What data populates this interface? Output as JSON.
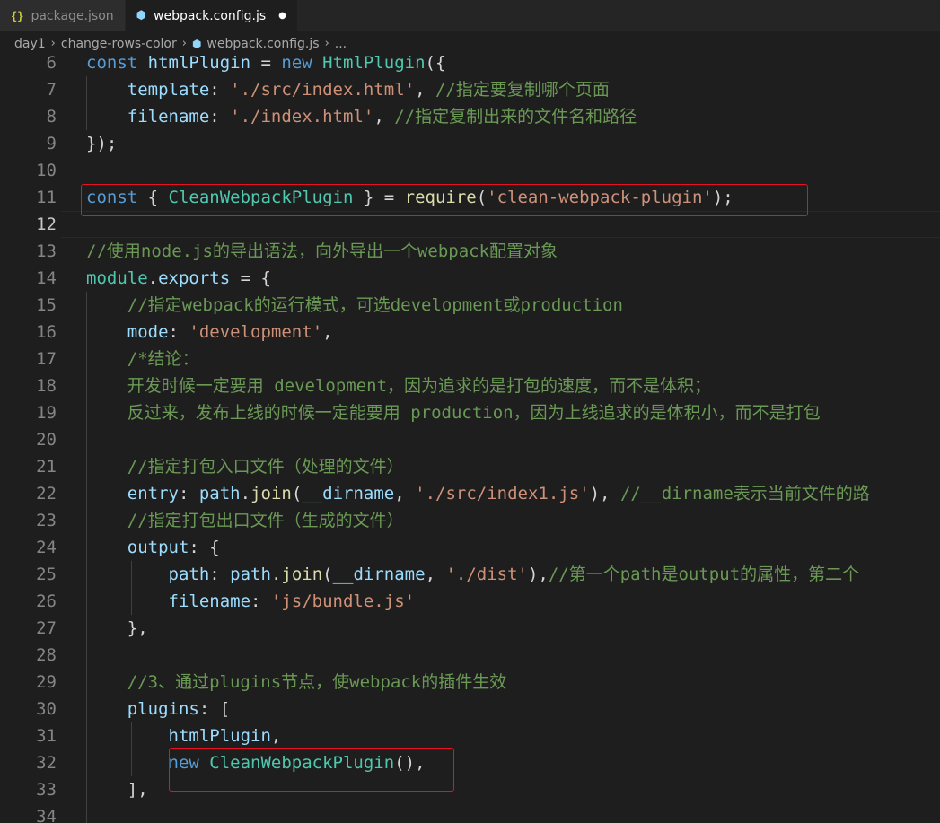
{
  "tabs": [
    {
      "name": "package-json",
      "icon": "json-braces-icon",
      "icon_text": "{}",
      "label": "package.json",
      "active": false
    },
    {
      "name": "webpack-config-js",
      "icon": "webpack-cube-icon",
      "icon_text": "⬢",
      "label": "webpack.config.js",
      "active": true,
      "dirty_marker": "●"
    }
  ],
  "breadcrumb": {
    "items": [
      "day1",
      "change-rows-color",
      "webpack.config.js",
      "..."
    ],
    "separator": "›"
  },
  "editor": {
    "line_numbers": [
      "6",
      "7",
      "8",
      "9",
      "10",
      "11",
      "12",
      "13",
      "14",
      "15",
      "16",
      "17",
      "18",
      "19",
      "20",
      "21",
      "22",
      "23",
      "24",
      "25",
      "26",
      "27",
      "28",
      "29",
      "30",
      "31",
      "32",
      "33",
      "34"
    ],
    "current_line": "12",
    "lines": [
      [
        [
          "kw",
          "const "
        ],
        [
          "var",
          "htmlPlugin "
        ],
        [
          "plain",
          "= "
        ],
        [
          "kw",
          "new "
        ],
        [
          "cls",
          "HtmlPlugin"
        ],
        [
          "plain",
          "({"
        ]
      ],
      [
        [
          "plain",
          "    "
        ],
        [
          "var",
          "template"
        ],
        [
          "plain",
          ": "
        ],
        [
          "str",
          "'./src/index.html'"
        ],
        [
          "plain",
          ", "
        ],
        [
          "cmt",
          "//指定要复制哪个页面"
        ]
      ],
      [
        [
          "plain",
          "    "
        ],
        [
          "var",
          "filename"
        ],
        [
          "plain",
          ": "
        ],
        [
          "str",
          "'./index.html'"
        ],
        [
          "plain",
          ", "
        ],
        [
          "cmt",
          "//指定复制出来的文件名和路径"
        ]
      ],
      [
        [
          "plain",
          "});"
        ]
      ],
      [],
      [
        [
          "kw",
          "const "
        ],
        [
          "plain",
          "{ "
        ],
        [
          "cls",
          "CleanWebpackPlugin"
        ],
        [
          "plain",
          " } = "
        ],
        [
          "fn",
          "require"
        ],
        [
          "plain",
          "("
        ],
        [
          "str",
          "'clean-webpack-plugin'"
        ],
        [
          "plain",
          ");"
        ]
      ],
      [],
      [
        [
          "cmt",
          "//使用node.js的导出语法，向外导出一个webpack配置对象"
        ]
      ],
      [
        [
          "cls",
          "module"
        ],
        [
          "plain",
          "."
        ],
        [
          "var",
          "exports"
        ],
        [
          "plain",
          " = {"
        ]
      ],
      [
        [
          "plain",
          "    "
        ],
        [
          "cmt",
          "//指定webpack的运行模式，可选development或production"
        ]
      ],
      [
        [
          "plain",
          "    "
        ],
        [
          "var",
          "mode"
        ],
        [
          "plain",
          ": "
        ],
        [
          "str",
          "'development'"
        ],
        [
          "plain",
          ","
        ]
      ],
      [
        [
          "plain",
          "    "
        ],
        [
          "cmt",
          "/*结论："
        ]
      ],
      [
        [
          "plain",
          "    "
        ],
        [
          "cmt",
          "开发时候一定要用 development，因为追求的是打包的速度，而不是体积；"
        ]
      ],
      [
        [
          "plain",
          "    "
        ],
        [
          "cmt",
          "反过来，发布上线的时候一定能要用 production，因为上线追求的是体积小，而不是打包"
        ]
      ],
      [],
      [
        [
          "plain",
          "    "
        ],
        [
          "cmt",
          "//指定打包入口文件（处理的文件）"
        ]
      ],
      [
        [
          "plain",
          "    "
        ],
        [
          "var",
          "entry"
        ],
        [
          "plain",
          ": "
        ],
        [
          "var",
          "path"
        ],
        [
          "plain",
          "."
        ],
        [
          "fn",
          "join"
        ],
        [
          "plain",
          "("
        ],
        [
          "var",
          "__dirname"
        ],
        [
          "plain",
          ", "
        ],
        [
          "str",
          "'./src/index1.js'"
        ],
        [
          "plain",
          "), "
        ],
        [
          "cmt",
          "//__dirname表示当前文件的路"
        ]
      ],
      [
        [
          "plain",
          "    "
        ],
        [
          "cmt",
          "//指定打包出口文件（生成的文件）"
        ]
      ],
      [
        [
          "plain",
          "    "
        ],
        [
          "var",
          "output"
        ],
        [
          "plain",
          ": {"
        ]
      ],
      [
        [
          "plain",
          "        "
        ],
        [
          "var",
          "path"
        ],
        [
          "plain",
          ": "
        ],
        [
          "var",
          "path"
        ],
        [
          "plain",
          "."
        ],
        [
          "fn",
          "join"
        ],
        [
          "plain",
          "("
        ],
        [
          "var",
          "__dirname"
        ],
        [
          "plain",
          ", "
        ],
        [
          "str",
          "'./dist'"
        ],
        [
          "plain",
          "),"
        ],
        [
          "cmt",
          "//第一个path是output的属性，第二个"
        ]
      ],
      [
        [
          "plain",
          "        "
        ],
        [
          "var",
          "filename"
        ],
        [
          "plain",
          ": "
        ],
        [
          "str",
          "'js/bundle.js'"
        ]
      ],
      [
        [
          "plain",
          "    },"
        ]
      ],
      [],
      [
        [
          "plain",
          "    "
        ],
        [
          "cmt",
          "//3、通过plugins节点，使webpack的插件生效"
        ]
      ],
      [
        [
          "plain",
          "    "
        ],
        [
          "var",
          "plugins"
        ],
        [
          "plain",
          ": ["
        ]
      ],
      [
        [
          "plain",
          "        "
        ],
        [
          "var",
          "htmlPlugin"
        ],
        [
          "plain",
          ","
        ]
      ],
      [
        [
          "plain",
          "        "
        ],
        [
          "kw",
          "new "
        ],
        [
          "cls",
          "CleanWebpackPlugin"
        ],
        [
          "plain",
          "(),"
        ]
      ],
      [
        [
          "plain",
          "    ],"
        ]
      ],
      []
    ]
  },
  "annotations": [
    {
      "name": "highlight-require-clean-plugin",
      "color": "#e81123"
    },
    {
      "name": "highlight-new-clean-plugin",
      "color": "#e81123"
    }
  ]
}
